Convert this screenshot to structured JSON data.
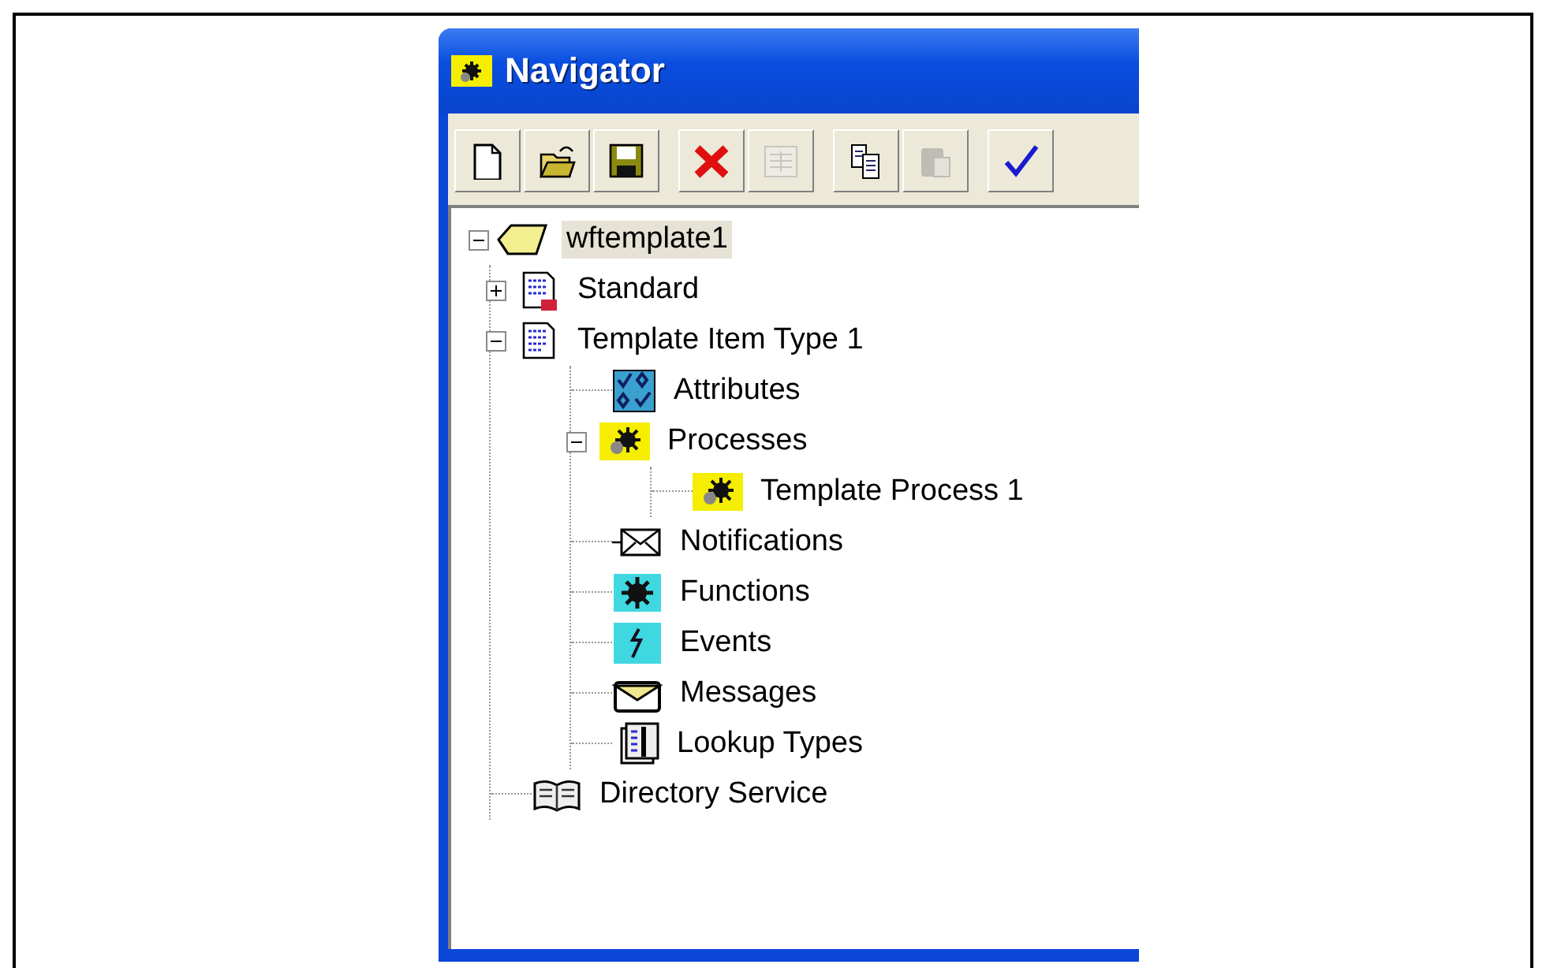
{
  "window": {
    "title": "Navigator"
  },
  "toolbar": [
    {
      "kind": "new",
      "disabled": false
    },
    {
      "kind": "open",
      "disabled": false
    },
    {
      "kind": "save",
      "disabled": false
    },
    {
      "kind": "delete",
      "disabled": false
    },
    {
      "kind": "properties",
      "disabled": true
    },
    {
      "kind": "copy",
      "disabled": false
    },
    {
      "kind": "paste",
      "disabled": true
    },
    {
      "kind": "verify",
      "disabled": false
    }
  ],
  "tree": [
    {
      "label": "wftemplate1",
      "kind": "data-store",
      "expanded": true,
      "selected": true,
      "children": [
        {
          "label": "Standard",
          "kind": "item-type-locked",
          "expanded": false,
          "selected": false
        },
        {
          "label": "Template Item Type 1",
          "kind": "item-type",
          "expanded": true,
          "selected": false,
          "children": [
            {
              "label": "Attributes",
              "kind": "attributes",
              "selected": false
            },
            {
              "label": "Processes",
              "kind": "process",
              "expanded": true,
              "selected": false,
              "children": [
                {
                  "label": "Template Process 1",
                  "kind": "process",
                  "selected": false
                }
              ]
            },
            {
              "label": "Notifications",
              "kind": "notification",
              "selected": false
            },
            {
              "label": "Functions",
              "kind": "function",
              "selected": false
            },
            {
              "label": "Events",
              "kind": "event",
              "selected": false
            },
            {
              "label": "Messages",
              "kind": "message",
              "selected": false
            },
            {
              "label": "Lookup Types",
              "kind": "lookup",
              "selected": false
            }
          ]
        },
        {
          "label": "Directory Service",
          "kind": "directory",
          "selected": false
        }
      ]
    }
  ]
}
